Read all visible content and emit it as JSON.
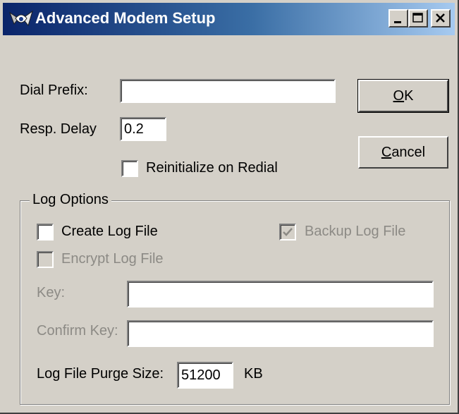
{
  "window": {
    "title": "Advanced Modem Setup",
    "icon": "modem-app-icon",
    "controls": [
      "minimize-icon",
      "maximize-icon",
      "close-icon"
    ]
  },
  "form": {
    "dial_prefix": {
      "label": "Dial Prefix:",
      "value": ""
    },
    "resp_delay": {
      "label": "Resp. Delay",
      "value": "0.2"
    },
    "reinitialize": {
      "label": "Reinitialize on Redial",
      "checked": false
    }
  },
  "buttons": {
    "ok": {
      "label_mnemonic": "O",
      "label_rest": "K"
    },
    "cancel": {
      "label_mnemonic": "C",
      "label_rest": "ancel"
    }
  },
  "log_options": {
    "legend": "Log Options",
    "create_log": {
      "label": "Create Log File",
      "checked": false,
      "enabled": true
    },
    "backup_log": {
      "label": "Backup Log File",
      "checked": true,
      "enabled": false
    },
    "encrypt_log": {
      "label": "Encrypt Log File",
      "checked": false,
      "enabled": false
    },
    "key": {
      "label": "Key:",
      "value": "",
      "enabled": false
    },
    "confirm_key": {
      "label": "Confirm Key:",
      "value": "",
      "enabled": false
    },
    "purge_size": {
      "label": "Log File Purge Size:",
      "value": "51200",
      "unit": "KB"
    }
  },
  "colors": {
    "face": "#d4d0c8",
    "title_start": "#0a246a",
    "title_end": "#a6caf0",
    "disabled_text": "#8c8a85"
  }
}
